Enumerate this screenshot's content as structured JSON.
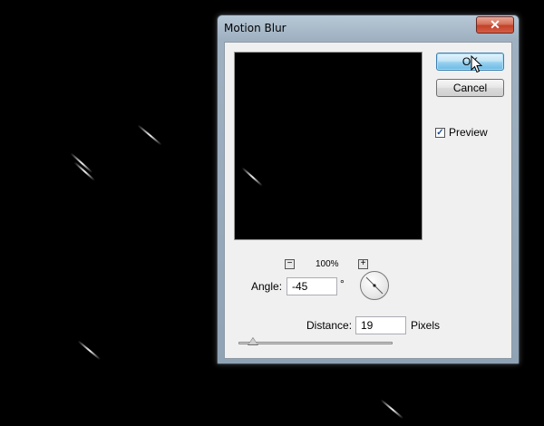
{
  "window": {
    "title": "Motion Blur",
    "close_glyph": "✕"
  },
  "buttons": {
    "ok_label": "OK",
    "cancel_label": "Cancel"
  },
  "preview_toggle": {
    "label": "Preview",
    "checked": true
  },
  "zoom": {
    "level": "100%",
    "zoom_out_glyph": "−",
    "zoom_in_glyph": "+"
  },
  "angle": {
    "label": "Angle:",
    "value": "-45",
    "unit": "°"
  },
  "distance": {
    "label": "Distance:",
    "value": "19",
    "unit": "Pixels"
  },
  "colors": {
    "canvas_background": "#000000",
    "dialog_client": "#f0f0f0",
    "ok_accent": "#98d1ef",
    "close_button": "#c2412a"
  },
  "icons": {
    "close": "close-icon",
    "checkbox": "checkmark-icon",
    "zoom_out": "zoom-out-icon",
    "zoom_in": "zoom-in-icon",
    "angle_dial": "angle-dial-icon",
    "pointer": "mouse-pointer-icon"
  }
}
